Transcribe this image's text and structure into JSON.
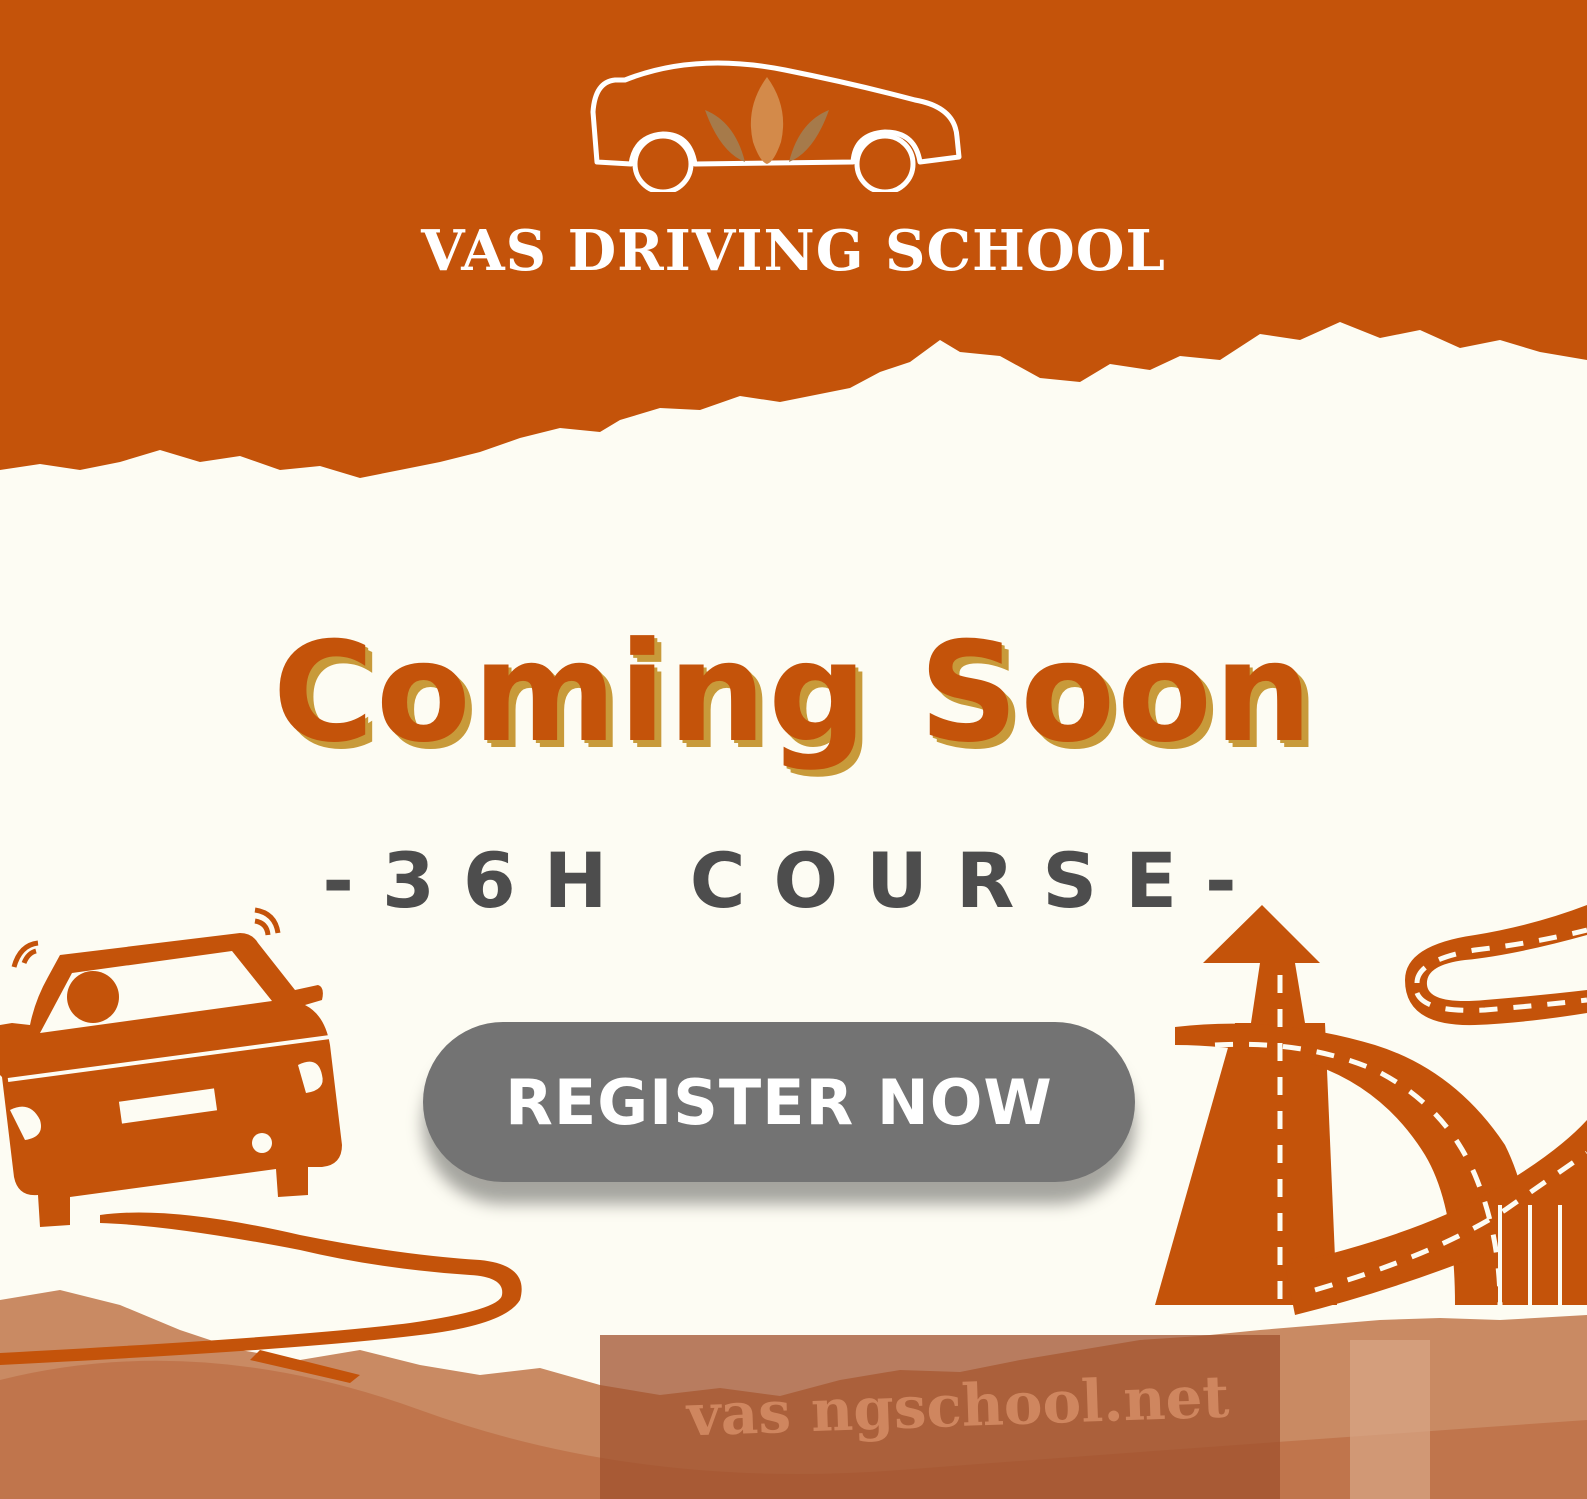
{
  "brand": {
    "name": "VAS DRIVING SCHOOL"
  },
  "headline": "Coming Soon",
  "subheadline": "-36H COURSE-",
  "cta": {
    "label": "REGISTER NOW"
  },
  "background_sign_text": "vas    ngschool.net",
  "colors": {
    "primary_orange": "#c4530a",
    "cream": "#fdfcf3",
    "headline_shadow": "#c89a3a",
    "text_gray": "#4d4d4d",
    "button_gray": "#737373"
  },
  "icons": [
    "logo-car-icon",
    "flame-icon",
    "car-driving-icon",
    "winding-road-icon",
    "highway-roads-icon"
  ]
}
